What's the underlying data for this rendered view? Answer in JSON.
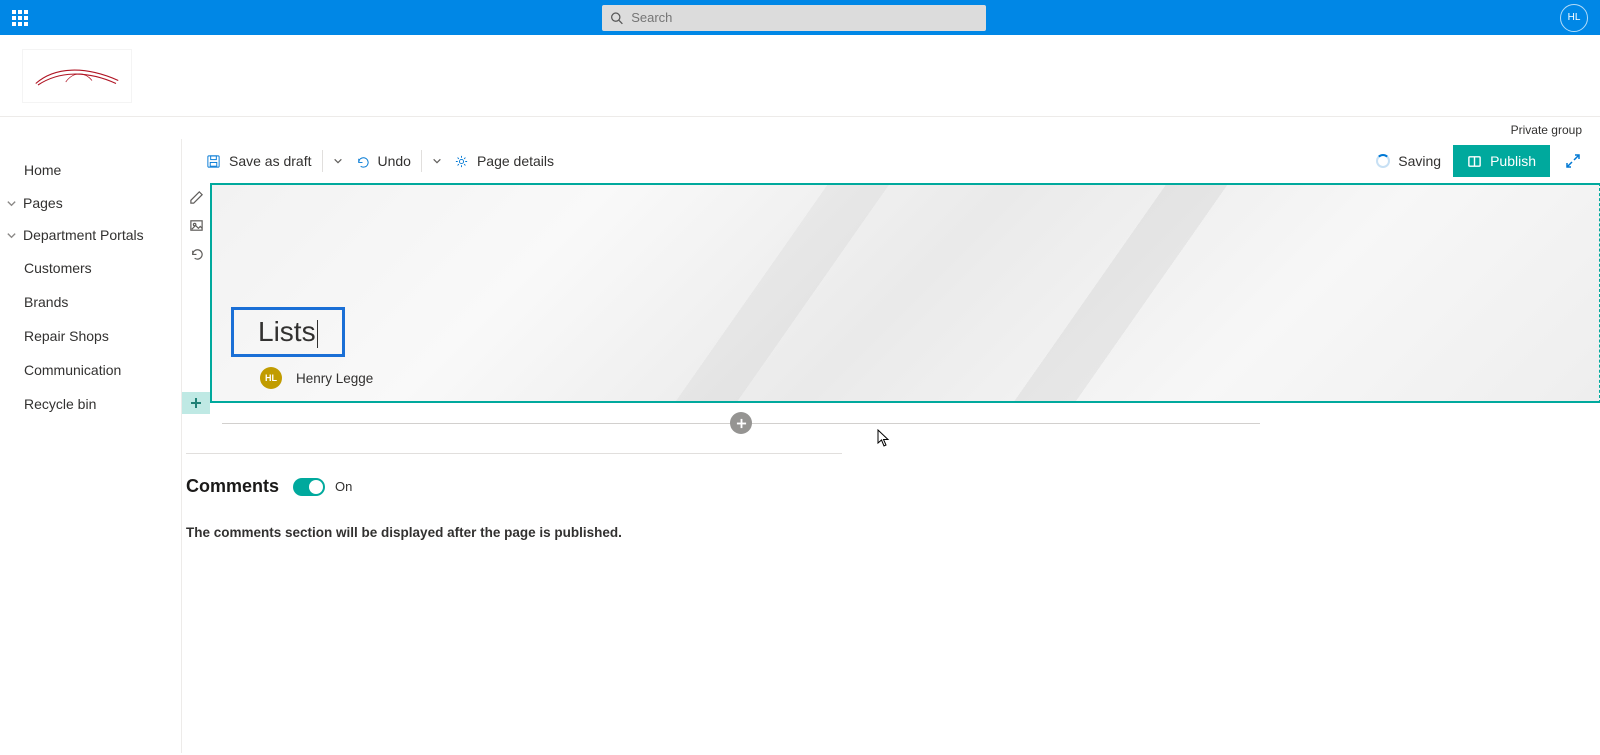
{
  "topbar": {
    "search_placeholder": "Search",
    "avatar_initials": "HL"
  },
  "site": {
    "privacy_label": "Private group"
  },
  "nav": {
    "home": "Home",
    "pages": "Pages",
    "department_portals": "Department Portals",
    "items": {
      "customers": "Customers",
      "brands": "Brands",
      "repair_shops": "Repair Shops",
      "communication": "Communication"
    },
    "recycle_bin": "Recycle bin"
  },
  "cmdbar": {
    "save_as_draft": "Save as draft",
    "undo": "Undo",
    "page_details": "Page details",
    "saving": "Saving",
    "publish": "Publish"
  },
  "hero": {
    "title": "Lists",
    "author_initials": "HL",
    "author_name": "Henry Legge"
  },
  "comments": {
    "heading": "Comments",
    "state_label": "On",
    "note": "The comments section will be displayed after the page is published."
  }
}
